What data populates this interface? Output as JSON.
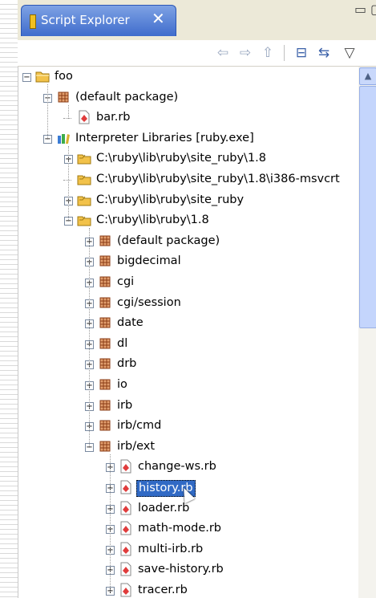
{
  "view": {
    "tab_title": "Script Explorer",
    "close_glyph": "✕",
    "minimize_glyph": "▭",
    "maximize_glyph": "▢",
    "view_menu_glyph": "▽"
  },
  "toolbar": {
    "back_glyph": "⇦",
    "forward_glyph": "⇨",
    "up_glyph": "⇧",
    "collapse_glyph": "⊟",
    "link_glyph": "⇆"
  },
  "colors": {
    "selection": "#316ac5",
    "tab_active": "#4a78d6",
    "package": "#b8562a",
    "ruby_file": "#e03c3c",
    "folder": "#f2c24a"
  },
  "tree": [
    {
      "label": "foo",
      "depth": 0,
      "expander": "minus",
      "icon": "project-folder-icon"
    },
    {
      "label": "(default package)",
      "depth": 1,
      "expander": "minus",
      "icon": "package-icon"
    },
    {
      "label": "bar.rb",
      "depth": 2,
      "expander": "none",
      "icon": "ruby-file-icon"
    },
    {
      "label": "Interpreter Libraries [ruby.exe]",
      "depth": 1,
      "expander": "minus",
      "icon": "library-icon"
    },
    {
      "label": "C:\\ruby\\lib\\ruby\\site_ruby\\1.8",
      "depth": 2,
      "expander": "plus",
      "icon": "library-folder-icon"
    },
    {
      "label": "C:\\ruby\\lib\\ruby\\site_ruby\\1.8\\i386-msvcrt",
      "depth": 2,
      "expander": "none",
      "icon": "library-folder-icon"
    },
    {
      "label": "C:\\ruby\\lib\\ruby\\site_ruby",
      "depth": 2,
      "expander": "plus",
      "icon": "library-folder-icon"
    },
    {
      "label": "C:\\ruby\\lib\\ruby\\1.8",
      "depth": 2,
      "expander": "minus",
      "icon": "library-folder-icon"
    },
    {
      "label": "(default package)",
      "depth": 3,
      "expander": "plus",
      "icon": "package-icon"
    },
    {
      "label": "bigdecimal",
      "depth": 3,
      "expander": "plus",
      "icon": "package-icon"
    },
    {
      "label": "cgi",
      "depth": 3,
      "expander": "plus",
      "icon": "package-icon"
    },
    {
      "label": "cgi/session",
      "depth": 3,
      "expander": "plus",
      "icon": "package-icon"
    },
    {
      "label": "date",
      "depth": 3,
      "expander": "plus",
      "icon": "package-icon"
    },
    {
      "label": "dl",
      "depth": 3,
      "expander": "plus",
      "icon": "package-icon"
    },
    {
      "label": "drb",
      "depth": 3,
      "expander": "plus",
      "icon": "package-icon"
    },
    {
      "label": "io",
      "depth": 3,
      "expander": "plus",
      "icon": "package-icon"
    },
    {
      "label": "irb",
      "depth": 3,
      "expander": "plus",
      "icon": "package-icon"
    },
    {
      "label": "irb/cmd",
      "depth": 3,
      "expander": "plus",
      "icon": "package-icon"
    },
    {
      "label": "irb/ext",
      "depth": 3,
      "expander": "minus",
      "icon": "package-icon"
    },
    {
      "label": "change-ws.rb",
      "depth": 4,
      "expander": "plus",
      "icon": "ruby-file-icon"
    },
    {
      "label": "history.rb",
      "depth": 4,
      "expander": "plus",
      "icon": "ruby-file-icon",
      "selected": true
    },
    {
      "label": "loader.rb",
      "depth": 4,
      "expander": "plus",
      "icon": "ruby-file-icon"
    },
    {
      "label": "math-mode.rb",
      "depth": 4,
      "expander": "plus",
      "icon": "ruby-file-icon"
    },
    {
      "label": "multi-irb.rb",
      "depth": 4,
      "expander": "plus",
      "icon": "ruby-file-icon"
    },
    {
      "label": "save-history.rb",
      "depth": 4,
      "expander": "plus",
      "icon": "ruby-file-icon"
    },
    {
      "label": "tracer.rb",
      "depth": 4,
      "expander": "plus",
      "icon": "ruby-file-icon"
    }
  ],
  "scrollbar": {
    "up_glyph": "▲"
  }
}
